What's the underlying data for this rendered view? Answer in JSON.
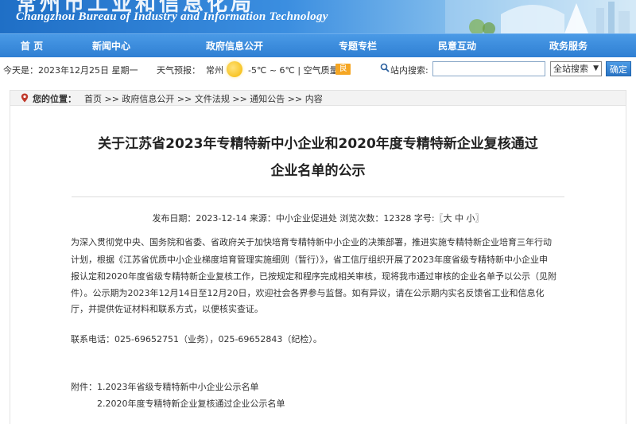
{
  "banner": {
    "cn_title": "常州市工业和信息化局",
    "en_title": "Changzhou Bureau of Industry and Information Technology"
  },
  "nav": [
    "首  页",
    "新闻中心",
    "政府信息公开",
    "专题专栏",
    "民意互动",
    "政务服务"
  ],
  "infobar": {
    "today": "今天是：2023年12月25日 星期一",
    "weather_label": "天气预报：",
    "city": "常州",
    "temp": "-5℃ ~ 6℃ | 空气质量:",
    "aqi": "良",
    "search_label": "站内搜索:",
    "search_value": "",
    "scope": "全站搜索",
    "go": "确定"
  },
  "breadcrumb": {
    "label": "您的位置：",
    "trail": "首页 >> 政府信息公开 >> 文件法规 >> 通知公告 >> 内容"
  },
  "article": {
    "title_line1": "关于江苏省2023年专精特新中小企业和2020年度专精特新企业复核通过",
    "title_line2": "企业名单的公示",
    "meta": "发布日期：2023-12-14  来源：中小企业促进处  浏览次数：12328  字号:〖大 中 小〗",
    "body": [
      "为深入贯彻党中央、国务院和省委、省政府关于加快培育专精特新中小企业的决策部署，推进实施专精特新企业培育三年行动",
      "计划，根据《江苏省优质中小企业梯度培育管理实施细则（暂行）》，省工信厅组织开展了2023年度省级专精特新中小企业申",
      "报认定和2020年度省级专精特新企业复核工作，已按规定和程序完成相关审核，现将我市通过审核的企业名单予以公示（见附",
      "件）。公示期为2023年12月14日至12月20日，欢迎社会各界参与监督。如有异议，请在公示期内实名反馈省工业和信息化",
      "厅，并提供佐证材料和联系方式，以便核实查证。"
    ],
    "contact": "联系电话：025-69652751（业务），025-69652843（纪检）。",
    "attach_label": "附件：",
    "attachments": [
      "1.2023年省级专精特新中小企业公示名单",
      "2.2020年度专精特新企业复核通过企业公示名单"
    ]
  }
}
